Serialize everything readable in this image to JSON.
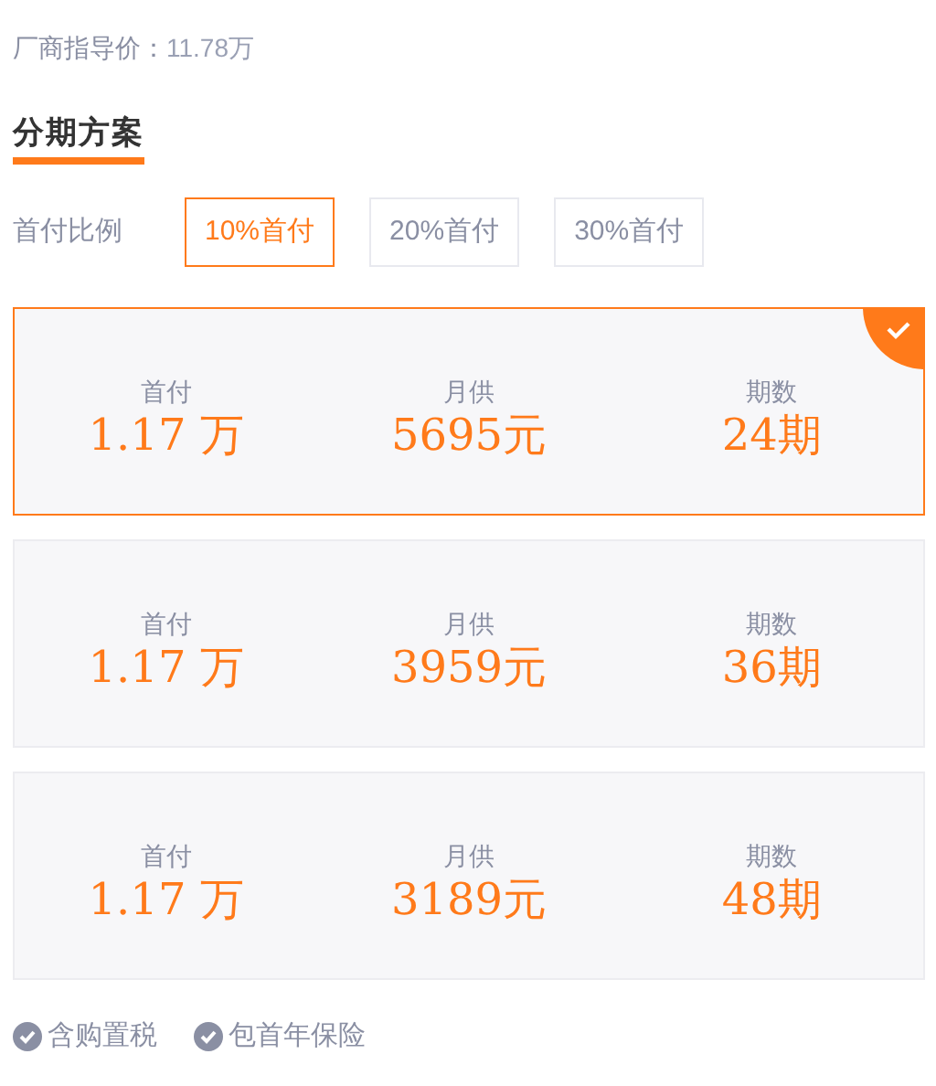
{
  "guide_price": {
    "label": "厂商指导价：",
    "value": "11.78万"
  },
  "section_title": "分期方案",
  "ratio": {
    "label": "首付比例",
    "options": [
      {
        "label": "10%首付",
        "selected": true
      },
      {
        "label": "20%首付",
        "selected": false
      },
      {
        "label": "30%首付",
        "selected": false
      }
    ]
  },
  "plans": [
    {
      "selected": true,
      "fields": [
        {
          "label": "首付",
          "value": "1.17 万"
        },
        {
          "label": "月供",
          "value": "5695元"
        },
        {
          "label": "期数",
          "value": "24期"
        }
      ]
    },
    {
      "selected": false,
      "fields": [
        {
          "label": "首付",
          "value": "1.17 万"
        },
        {
          "label": "月供",
          "value": "3959元"
        },
        {
          "label": "期数",
          "value": "36期"
        }
      ]
    },
    {
      "selected": false,
      "fields": [
        {
          "label": "首付",
          "value": "1.17 万"
        },
        {
          "label": "月供",
          "value": "3189元"
        },
        {
          "label": "期数",
          "value": "48期"
        }
      ]
    }
  ],
  "features": [
    "含购置税",
    "包首年保险"
  ]
}
